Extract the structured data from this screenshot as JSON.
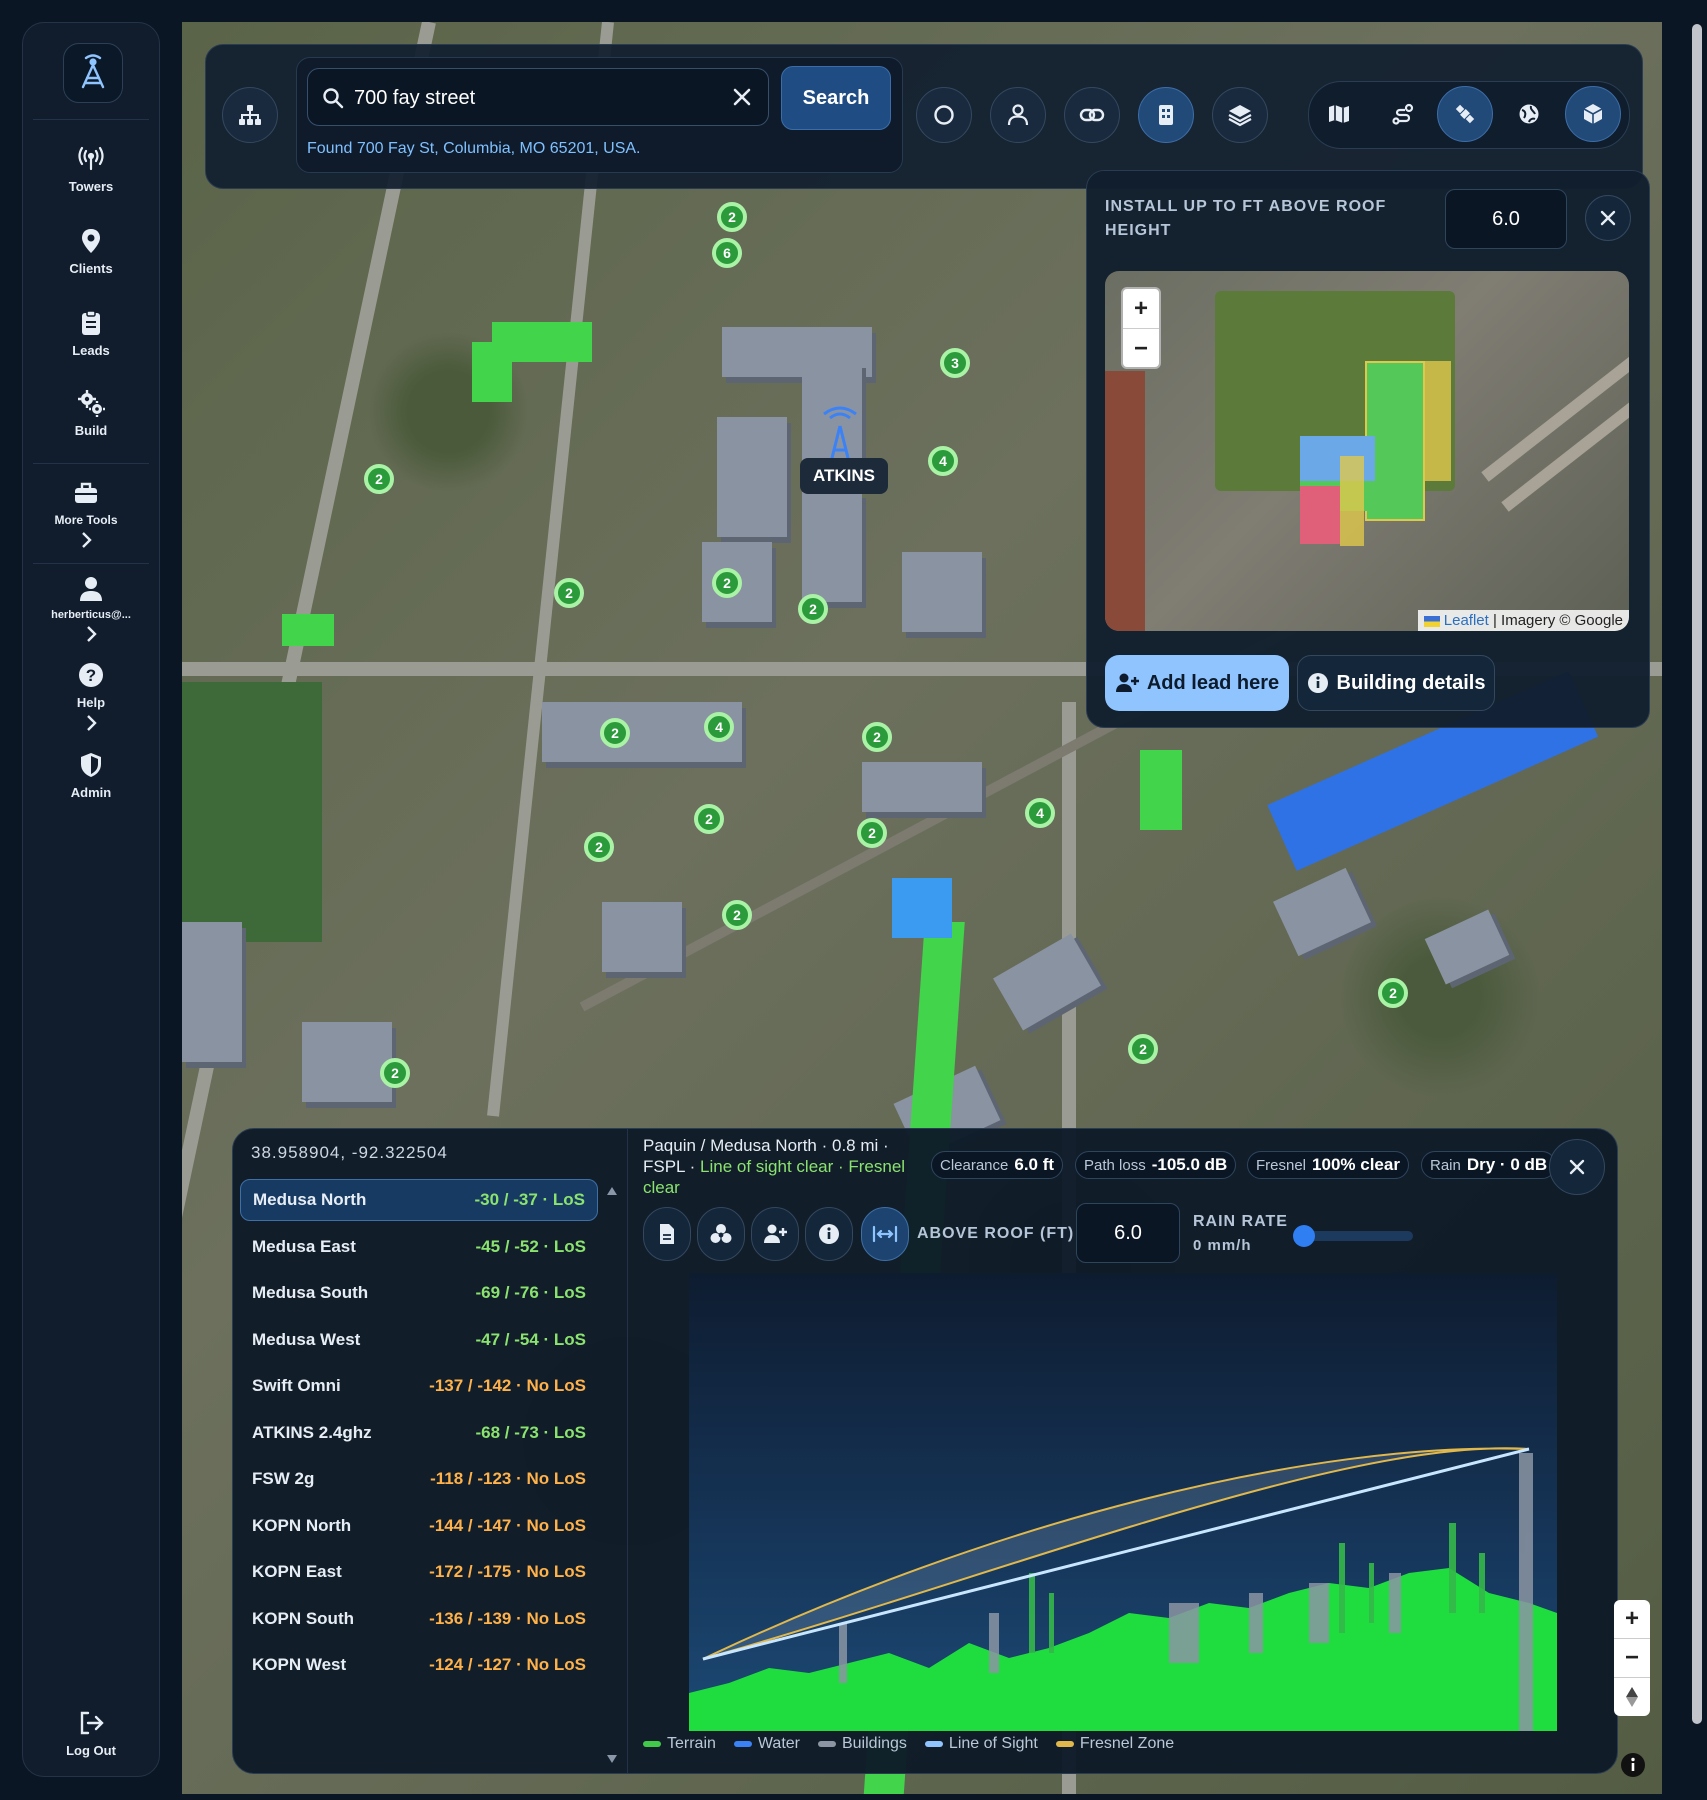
{
  "sidebar": {
    "items": [
      {
        "label": "Towers",
        "icon": "antenna-icon"
      },
      {
        "label": "Clients",
        "icon": "map-pin-icon"
      },
      {
        "label": "Leads",
        "icon": "clipboard-icon"
      },
      {
        "label": "Build",
        "icon": "gears-icon"
      },
      {
        "label": "More Tools",
        "icon": "toolbox-icon"
      },
      {
        "label": "herberticus@...",
        "icon": "user-icon"
      },
      {
        "label": "Help",
        "icon": "help-icon"
      },
      {
        "label": "Admin",
        "icon": "shield-icon"
      }
    ],
    "logout": "Log Out"
  },
  "search": {
    "value": "700 fay street",
    "button": "Search",
    "found": "Found 700 Fay St, Columbia, MO 65201, USA."
  },
  "map": {
    "tower_label": "ATKINS",
    "clusters": [
      "2",
      "6",
      "3",
      "2",
      "4",
      "2",
      "2",
      "2",
      "2",
      "4",
      "2",
      "2",
      "2",
      "4",
      "2",
      "2",
      "2",
      "2",
      "2"
    ]
  },
  "install_panel": {
    "title": "INSTALL UP TO FT ABOVE ROOF HEIGHT",
    "value": "6.0",
    "attribution_leaflet": "Leaflet",
    "attribution_imagery": "| Imagery © Google",
    "add_lead": "Add lead here",
    "building_details": "Building details"
  },
  "link_panel": {
    "coords": "38.958904, -92.322504",
    "towers": [
      {
        "name": "Medusa North",
        "value": "-30 / -37 · LoS",
        "los": true
      },
      {
        "name": "Medusa East",
        "value": "-45 / -52 · LoS",
        "los": true
      },
      {
        "name": "Medusa South",
        "value": "-69 / -76 · LoS",
        "los": true
      },
      {
        "name": "Medusa West",
        "value": "-47 / -54 · LoS",
        "los": true
      },
      {
        "name": "Swift Omni",
        "value": "-137 / -142 · No LoS",
        "los": false
      },
      {
        "name": "ATKINS 2.4ghz",
        "value": "-68 / -73 · LoS",
        "los": true
      },
      {
        "name": "FSW 2g",
        "value": "-118 / -123 · No LoS",
        "los": false
      },
      {
        "name": "KOPN North",
        "value": "-144 / -147 · No LoS",
        "los": false
      },
      {
        "name": "KOPN East",
        "value": "-172 / -175 · No LoS",
        "los": false
      },
      {
        "name": "KOPN South",
        "value": "-136 / -139 · No LoS",
        "los": false
      },
      {
        "name": "KOPN West",
        "value": "-124 / -127 · No LoS",
        "los": false
      }
    ],
    "header_line1": "Paquin / Medusa North · 0.8 mi ·",
    "header_line2a": "FSPL ·",
    "header_line2b": "Line of sight clear · Fresnel",
    "header_line3": "clear",
    "chips": {
      "clearance_label": "Clearance",
      "clearance_value": "6.0 ft",
      "pathloss_label": "Path loss",
      "pathloss_value": "-105.0 dB",
      "fresnel_label": "Fresnel",
      "fresnel_value": "100% clear",
      "rain_label": "Rain",
      "rain_value": "Dry · 0 dB"
    },
    "above_roof_label": "ABOVE ROOF (FT)",
    "above_roof_value": "6.0",
    "rain_rate_label": "RAIN RATE",
    "rain_rate_value": "0 mm/h",
    "rain_rate_level": 0,
    "legend": [
      "Terrain",
      "Water",
      "Buildings",
      "Line of Sight",
      "Fresnel Zone"
    ],
    "colors": {
      "terrain": "#43c94a",
      "water": "#3b82f6",
      "buildings": "#8b95a3",
      "los": "#8fc4ff",
      "fresnel": "#e0b84c"
    }
  }
}
